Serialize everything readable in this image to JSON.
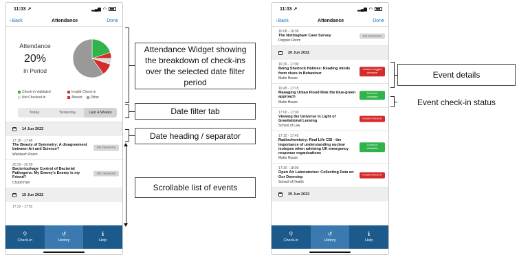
{
  "left_phone": {
    "status": {
      "time": "11:03 ↗"
    },
    "nav": {
      "back": "Back",
      "title": "Attendance",
      "done": "Done"
    },
    "widget": {
      "label": "Attendance",
      "percent": "20%",
      "period": "In Period",
      "legend": [
        "Check-in Validated",
        "Invalid Check-in",
        "Not Checked-in",
        "Absent",
        "Other"
      ],
      "legend_colors": [
        "#2fb34a",
        "#d42b2b",
        "#dddddd",
        "#d42b2b",
        "#999999"
      ]
    },
    "filters": [
      "Today",
      "Yesterday",
      "Last 4 Weeks"
    ],
    "active_filter": "Last 4 Weeks",
    "days": [
      {
        "date": "14 Jun 2022",
        "events": [
          {
            "time": "17:18 - 17:48",
            "title": "The Beauty of Symmetry: A disagreement between Art and Science?",
            "location": "Welsbach Room",
            "status": "Not Checked-in",
            "status_color": "grey"
          },
          {
            "time": "20:29 - 20:59",
            "title": "Bacteriophage Control of Bacterial Pathogens: My Enemy's Enemy is my Friend?",
            "location": "Chubb Hall",
            "status": "Not Checked-in",
            "status_color": "grey"
          }
        ]
      },
      {
        "date": "15 Jun 2022",
        "events": [
          {
            "time": "17:22 - 17:52",
            "title": "",
            "location": ""
          }
        ]
      }
    ],
    "tabs": [
      {
        "label": "Check-in",
        "icon": "●"
      },
      {
        "label": "History",
        "icon": "↺"
      },
      {
        "label": "Help",
        "icon": "ℹ"
      }
    ]
  },
  "right_phone": {
    "status": {
      "time": "11:03 ↗"
    },
    "nav": {
      "back": "Back",
      "title": "Attendance",
      "done": "Done"
    },
    "top_event": {
      "time": "16:08 - 16:38",
      "title": "The Nottingham Cave Survey",
      "location": "Doppler Room",
      "status": "Not Checked-in",
      "status_color": "grey"
    },
    "days": [
      {
        "date": "20 Jun 2022",
        "events": [
          {
            "time": "16:30 - 17:00",
            "title": "Being Sherlock Holmes: Reading minds from clues in Behaviour",
            "location": "Matts House",
            "status": "Lecturer logged Absence",
            "status_color": "red"
          },
          {
            "time": "16:45 - 17:15",
            "title": "Managing Urban Flood Risk the blue-green approach",
            "location": "Matts House",
            "status": "Check-in Validated",
            "status_color": "green"
          },
          {
            "time": "17:00 - 17:30",
            "title": "Viewing the Universe in Light of Gravitational Lensing",
            "location": "School of Law",
            "status": "Invalid Check-in",
            "status_color": "red"
          },
          {
            "time": "17:15 - 17:45",
            "title": "Radiochemistry: Real Life CSI - the importance of understanding nuclear isotopes when advising UK emergency response organisations",
            "location": "Matts House",
            "status": "Check-in Validated",
            "status_color": "green"
          },
          {
            "time": "17:30 - 18:00",
            "title": "Open Air Laboratories: Collecting Data on Our Doorstep",
            "location": "School of Health",
            "status": "Invalid Check-in",
            "status_color": "red"
          }
        ]
      },
      {
        "date": "29 Jun 2022",
        "events": []
      }
    ],
    "tabs": [
      {
        "label": "Check-in",
        "icon": "●"
      },
      {
        "label": "History",
        "icon": "↺"
      },
      {
        "label": "Help",
        "icon": "ℹ"
      }
    ]
  },
  "callouts": {
    "widget": "Attendance Widget showing the breakdown of check-ins over the selected date filter period",
    "filter": "Date filter tab",
    "date_heading": "Date heading / separator",
    "scroll": "Scrollable list of events",
    "event_details": "Event details",
    "checkin_status": "Event check-in status"
  },
  "chart_data": {
    "type": "pie",
    "title": "",
    "categories": [
      "Check-in Validated",
      "Invalid Check-in",
      "Not Checked-in",
      "Absent",
      "Other"
    ],
    "values": [
      20,
      5,
      5,
      10,
      60
    ],
    "colors": [
      "#2fb34a",
      "#d42b2b",
      "#dddddd",
      "#d42b2b",
      "#999999"
    ]
  }
}
